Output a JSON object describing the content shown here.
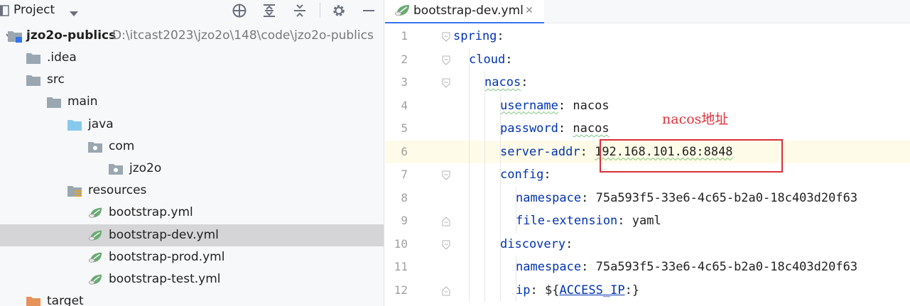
{
  "project_panel": {
    "title": "Project",
    "tree": [
      {
        "label": "jzo2o-publics",
        "path": "D:\\itcast2023\\jzo2o\\148\\code\\jzo2o-publics",
        "icon": "module-folder-icon",
        "expanded": true
      },
      {
        "label": ".idea",
        "icon": "folder-icon",
        "expanded": false
      },
      {
        "label": "src",
        "icon": "folder-icon",
        "expanded": true
      },
      {
        "label": "main",
        "icon": "folder-icon",
        "expanded": true
      },
      {
        "label": "java",
        "icon": "source-folder-icon",
        "expanded": true
      },
      {
        "label": "com",
        "icon": "package-icon",
        "expanded": true
      },
      {
        "label": "jzo2o",
        "icon": "package-icon",
        "expanded": false
      },
      {
        "label": "resources",
        "icon": "resources-folder-icon",
        "expanded": true
      },
      {
        "label": "bootstrap.yml",
        "icon": "spring-yml-icon"
      },
      {
        "label": "bootstrap-dev.yml",
        "icon": "spring-yml-icon",
        "selected": true
      },
      {
        "label": "bootstrap-prod.yml",
        "icon": "spring-yml-icon"
      },
      {
        "label": "bootstrap-test.yml",
        "icon": "spring-yml-icon"
      },
      {
        "label": "target",
        "icon": "excluded-folder-icon",
        "expanded": false
      }
    ]
  },
  "editor": {
    "tab_label": "bootstrap-dev.yml",
    "lines": [
      {
        "num": "1",
        "key": "spring",
        "sep": ":",
        "value": ""
      },
      {
        "num": "2",
        "key": "cloud",
        "sep": ":",
        "value": ""
      },
      {
        "num": "3",
        "key": "nacos",
        "sep": ":",
        "value": ""
      },
      {
        "num": "4",
        "key": "username",
        "sep": ": ",
        "value": "nacos"
      },
      {
        "num": "5",
        "key": "password",
        "sep": ": ",
        "value": "nacos"
      },
      {
        "num": "6",
        "key": "server-addr",
        "sep": ": ",
        "value": "192.168.101.68:8848"
      },
      {
        "num": "7",
        "key": "config",
        "sep": ":",
        "value": ""
      },
      {
        "num": "8",
        "key": "namespace",
        "sep": ": ",
        "value": "75a593f5-33e6-4c65-b2a0-18c403d20f63"
      },
      {
        "num": "9",
        "key": "file-extension",
        "sep": ": ",
        "value": "yaml"
      },
      {
        "num": "10",
        "key": "discovery",
        "sep": ":",
        "value": ""
      },
      {
        "num": "11",
        "key": "namespace",
        "sep": ": ",
        "value": "75a593f5-33e6-4c65-b2a0-18c403d20f63"
      },
      {
        "num": "12",
        "key": "ip",
        "sep": ": ",
        "value_prefix": "${",
        "value_ref": "ACCESS_IP",
        "value_suffix": ":}"
      }
    ],
    "annotation": "nacos地址"
  },
  "colors": {
    "yaml_key": "#0033b3",
    "annotation_red": "#e0303a",
    "selection_bg": "#d5d5d8",
    "current_line_bg": "#fefce8"
  }
}
